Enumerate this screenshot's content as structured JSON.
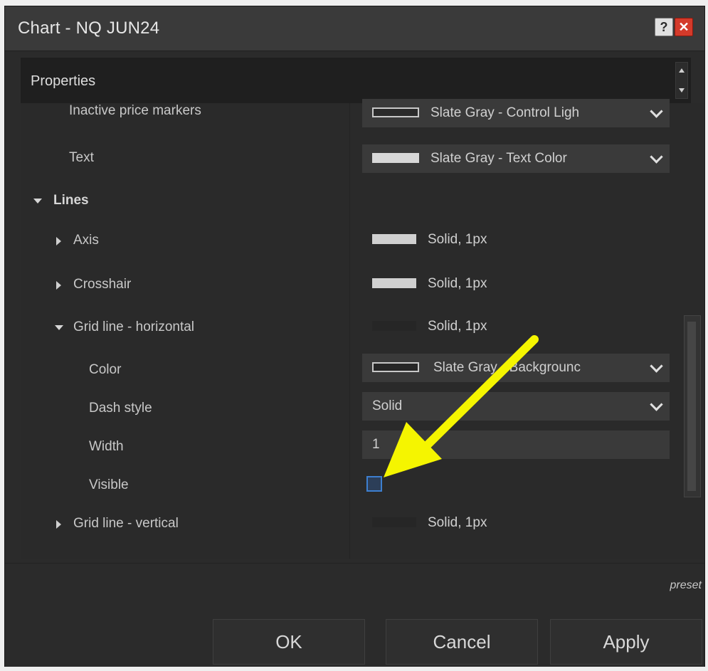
{
  "window": {
    "title": "Chart - NQ JUN24",
    "help_label": "?",
    "close_label": "✕"
  },
  "properties": {
    "header": "Properties",
    "rows": [
      {
        "label": "Inactive price markers",
        "value": "Slate Gray - Control Ligh",
        "swatch": "#2a2a2a",
        "swatch_border": "#c8c8c8"
      },
      {
        "label": "Text",
        "value": "Slate Gray - Text Color",
        "swatch": "#d8d8d8"
      },
      {
        "label": "Lines"
      },
      {
        "label": "Axis",
        "value": "Solid, 1px",
        "swatch": "#d0d0d0"
      },
      {
        "label": "Crosshair",
        "value": "Solid, 1px",
        "swatch": "#d0d0d0"
      },
      {
        "label": "Grid line - horizontal",
        "value": "Solid, 1px",
        "swatch": "#262626"
      },
      {
        "label": "Color",
        "value": "Slate Gray - Backgrounc",
        "swatch": "#262626",
        "swatch_border": "#c8c8c8"
      },
      {
        "label": "Dash style",
        "value": "Solid"
      },
      {
        "label": "Width",
        "value": "1"
      },
      {
        "label": "Visible",
        "checked": false
      },
      {
        "label": "Grid line - vertical",
        "value": "Solid, 1px",
        "swatch": "#262626"
      }
    ]
  },
  "footer": {
    "preset_label": "preset",
    "ok_label": "OK",
    "cancel_label": "Cancel",
    "apply_label": "Apply"
  },
  "colors": {
    "background": "#2b2b2b",
    "annotation_arrow": "#f5f500",
    "checkbox_border": "#3d7fd0"
  },
  "icons": [
    "help-icon",
    "close-icon",
    "expand-triangle-icon",
    "collapse-triangle-icon",
    "chevron-down-icon",
    "arrow-annotation-icon"
  ]
}
